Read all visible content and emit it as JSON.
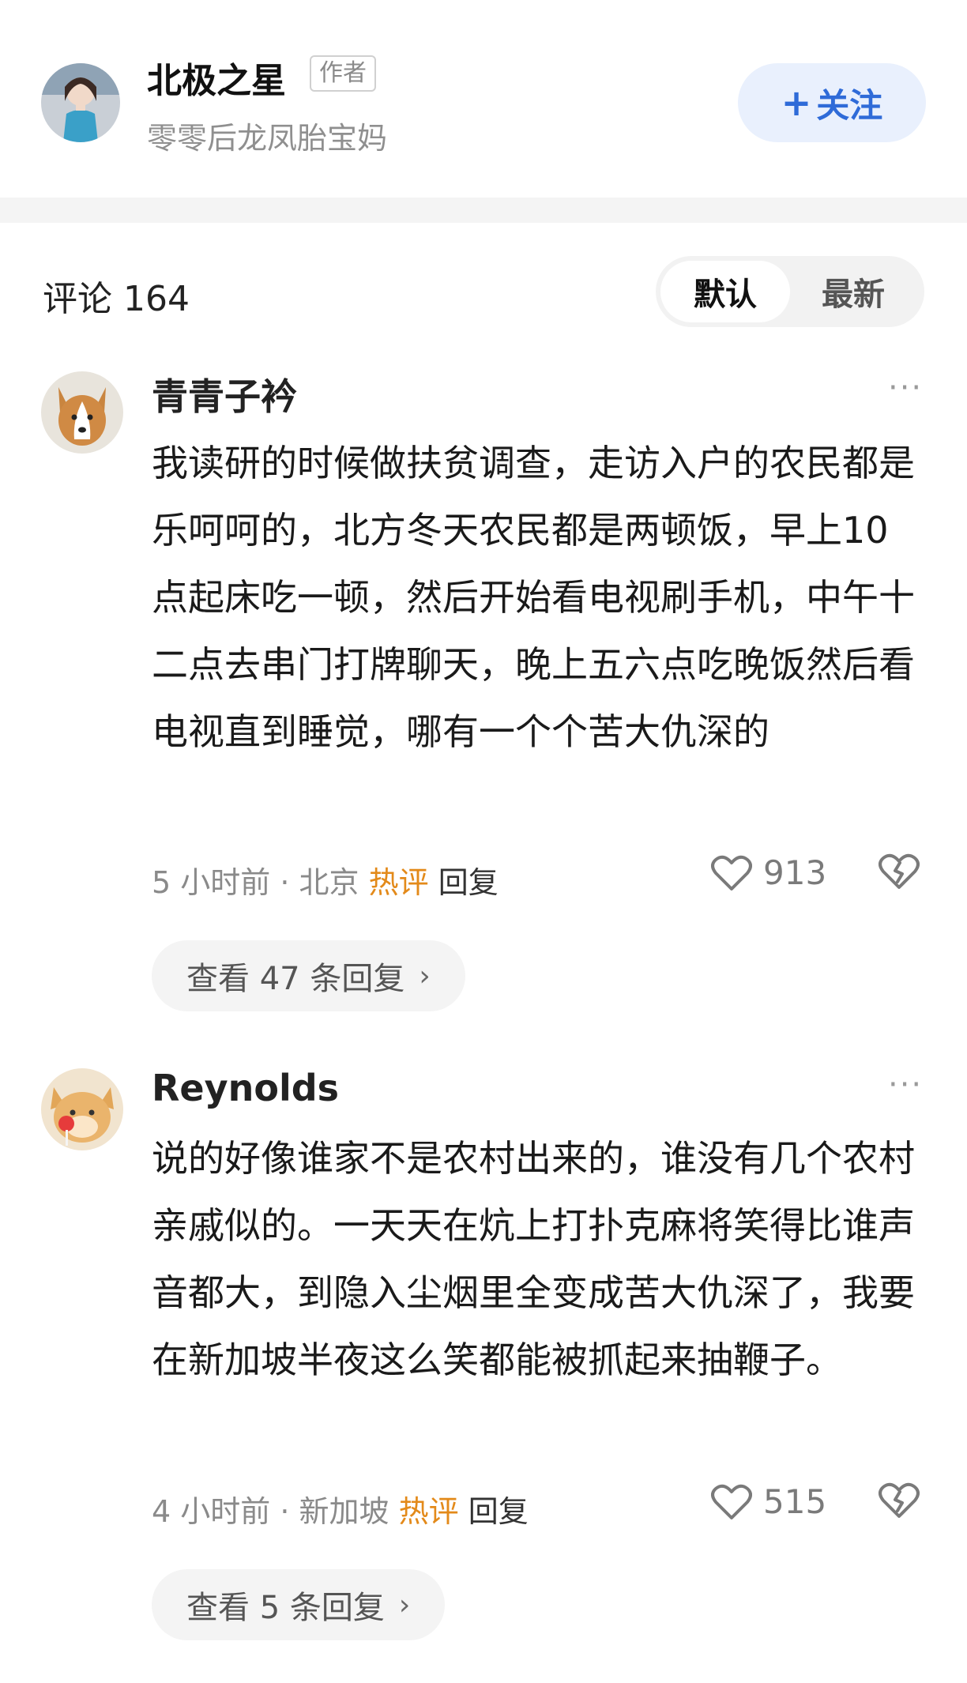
{
  "author": {
    "name": "北极之星",
    "badge": "作者",
    "bio": "零零后龙凤胎宝妈",
    "follow_icon": "+",
    "follow_label": "关注"
  },
  "comments_header": {
    "title": "评论 164",
    "sort_options": [
      "默认",
      "最新"
    ],
    "active_sort": "默认"
  },
  "comments": [
    {
      "username": "青青子衿",
      "avatar": "corgi-avatar",
      "text": "我读研的时候做扶贫调查，走访入户的农民都是乐呵呵的，北方冬天农民都是两顿饭，早上10点起床吃一顿，然后开始看电视刷手机，中午十二点去串门打牌聊天，晚上五六点吃晚饭然后看电视直到睡觉，哪有一个个苦大仇深的",
      "time": "5 小时前",
      "location": "北京",
      "tag": "热评",
      "reply_label": "回复",
      "likes": "913",
      "view_replies": "查看 47 条回复"
    },
    {
      "username": "Reynolds",
      "avatar": "cat-lollipop-avatar",
      "text": "说的好像谁家不是农村出来的，谁没有几个农村亲戚似的。一天天在炕上打扑克麻将笑得比谁声音都大，到隐入尘烟里全变成苦大仇深了，我要在新加坡半夜这么笑都能被抓起来抽鞭子。",
      "time": "4 小时前",
      "location": "新加坡",
      "tag": "热评",
      "reply_label": "回复",
      "likes": "515",
      "view_replies": "查看 5 条回复"
    }
  ],
  "more_label": "···",
  "meta_separator": "·",
  "chevron": "›",
  "colors": {
    "accent_blue": "#2f6bd8",
    "hot_tag": "#e38a1a",
    "follow_bg": "#e9f0fd"
  }
}
